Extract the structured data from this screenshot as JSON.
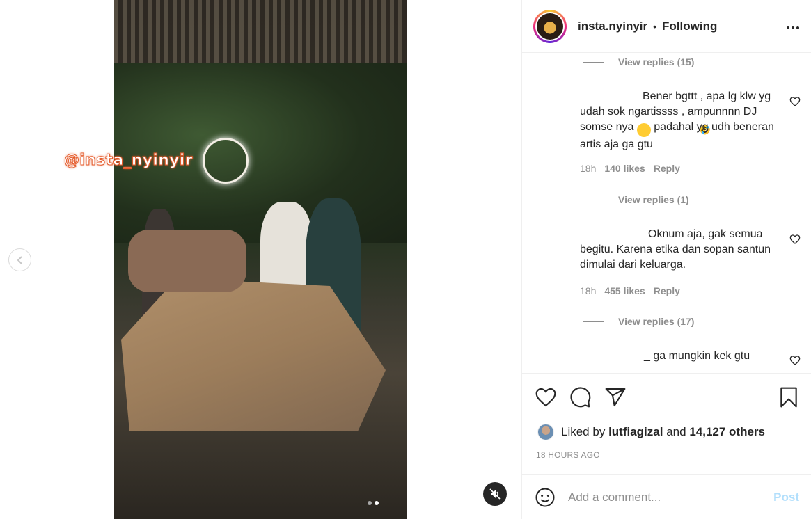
{
  "video": {
    "watermark": "@insta_nyinyir",
    "carousel_dots": 2,
    "active_dot": 2
  },
  "header": {
    "username": "insta.nyinyir",
    "separator": "•",
    "follow_status": "Following",
    "more_icon": "more-icon"
  },
  "comments": {
    "view_replies_1": "View replies (15)",
    "comment_1": {
      "text_a": "Bener bgttt , apa lg klw yg udah sok ngartissss , ampunnnn DJ somse nya",
      "text_b": "padahal yg udh beneran artis aja ga gtu",
      "emoji": "🤣",
      "time": "18h",
      "likes": "140 likes",
      "reply": "Reply"
    },
    "view_replies_2": "View replies (1)",
    "comment_2": {
      "text": "Oknum aja, gak semua begitu. Karena etika dan sopan santun dimulai dari keluarga.",
      "time": "18h",
      "likes": "455 likes",
      "reply": "Reply"
    },
    "view_replies_3": "View replies (17)",
    "comment_3": {
      "text": "_ ga mungkin kek gtu"
    }
  },
  "actions": {
    "liked_prefix": "Liked by",
    "liked_user": "lutfiagizal",
    "liked_and": "and",
    "liked_others": "14,127 others",
    "timestamp": "18 HOURS AGO"
  },
  "add_comment": {
    "placeholder": "Add a comment...",
    "post_label": "Post"
  },
  "colors": {
    "text": "#262626",
    "secondary": "#8e8e8e",
    "post_disabled": "#b2dffc",
    "watermark_stroke": "#e55b2b"
  }
}
